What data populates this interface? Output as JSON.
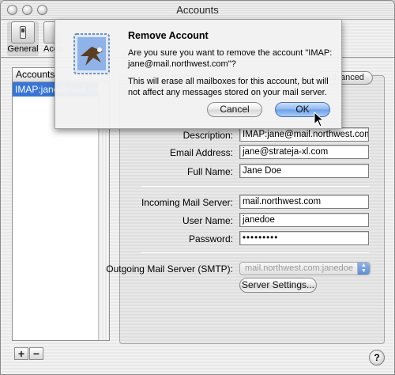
{
  "window": {
    "title": "Accounts"
  },
  "toolbar": {
    "general_label": "General",
    "accounts_label": "Accounts"
  },
  "accounts_list": {
    "header": "Accounts",
    "selected_account": "IMAP:jane@mail.northwest.com"
  },
  "tabs": {
    "advanced_label": "Advanced"
  },
  "form": {
    "description": {
      "label": "Description:",
      "value": "IMAP:jane@mail.northwest.com"
    },
    "email": {
      "label": "Email Address:",
      "value": "jane@strateja-xl.com"
    },
    "full_name": {
      "label": "Full Name:",
      "value": "Jane Doe"
    },
    "incoming_server": {
      "label": "Incoming Mail Server:",
      "value": "mail.northwest.com"
    },
    "user_name": {
      "label": "User Name:",
      "value": "janedoe"
    },
    "password": {
      "label": "Password:",
      "value": "•••••••••"
    },
    "smtp": {
      "label": "Outgoing Mail Server (SMTP):",
      "value": "mail.northwest.com:janedoe"
    },
    "server_settings_label": "Server Settings..."
  },
  "list_buttons": {
    "add": "+",
    "remove": "−"
  },
  "help": {
    "label": "?"
  },
  "dialog": {
    "title": "Remove Account",
    "message_line1": "Are you sure you want to remove the account \"IMAP:",
    "message_line2": "jane@mail.northwest.com\"?",
    "info_line1": "This will erase all mailboxes for this account, but will",
    "info_line2": "not affect any messages stored on your mail server.",
    "cancel_label": "Cancel",
    "ok_label": "OK"
  },
  "colors": {
    "selection": "#3875d7",
    "default_button": "#6a9fe6"
  },
  "icons": {
    "close": "traffic-close-icon",
    "minimize": "traffic-minimize-icon",
    "zoom": "traffic-zoom-icon",
    "general": "light-switch-icon",
    "mail": "mail-stamp-eagle-icon",
    "cursor": "arrow-cursor-icon"
  }
}
